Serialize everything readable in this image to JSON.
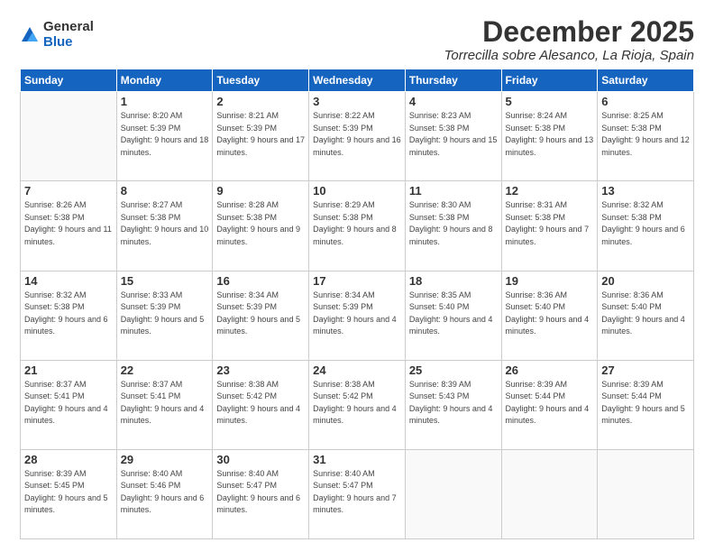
{
  "logo": {
    "general": "General",
    "blue": "Blue"
  },
  "title": "December 2025",
  "location": "Torrecilla sobre Alesanco, La Rioja, Spain",
  "days_of_week": [
    "Sunday",
    "Monday",
    "Tuesday",
    "Wednesday",
    "Thursday",
    "Friday",
    "Saturday"
  ],
  "weeks": [
    [
      {
        "day": "",
        "sunrise": "",
        "sunset": "",
        "daylight": ""
      },
      {
        "day": "1",
        "sunrise": "Sunrise: 8:20 AM",
        "sunset": "Sunset: 5:39 PM",
        "daylight": "Daylight: 9 hours and 18 minutes."
      },
      {
        "day": "2",
        "sunrise": "Sunrise: 8:21 AM",
        "sunset": "Sunset: 5:39 PM",
        "daylight": "Daylight: 9 hours and 17 minutes."
      },
      {
        "day": "3",
        "sunrise": "Sunrise: 8:22 AM",
        "sunset": "Sunset: 5:39 PM",
        "daylight": "Daylight: 9 hours and 16 minutes."
      },
      {
        "day": "4",
        "sunrise": "Sunrise: 8:23 AM",
        "sunset": "Sunset: 5:38 PM",
        "daylight": "Daylight: 9 hours and 15 minutes."
      },
      {
        "day": "5",
        "sunrise": "Sunrise: 8:24 AM",
        "sunset": "Sunset: 5:38 PM",
        "daylight": "Daylight: 9 hours and 13 minutes."
      },
      {
        "day": "6",
        "sunrise": "Sunrise: 8:25 AM",
        "sunset": "Sunset: 5:38 PM",
        "daylight": "Daylight: 9 hours and 12 minutes."
      }
    ],
    [
      {
        "day": "7",
        "sunrise": "Sunrise: 8:26 AM",
        "sunset": "Sunset: 5:38 PM",
        "daylight": "Daylight: 9 hours and 11 minutes."
      },
      {
        "day": "8",
        "sunrise": "Sunrise: 8:27 AM",
        "sunset": "Sunset: 5:38 PM",
        "daylight": "Daylight: 9 hours and 10 minutes."
      },
      {
        "day": "9",
        "sunrise": "Sunrise: 8:28 AM",
        "sunset": "Sunset: 5:38 PM",
        "daylight": "Daylight: 9 hours and 9 minutes."
      },
      {
        "day": "10",
        "sunrise": "Sunrise: 8:29 AM",
        "sunset": "Sunset: 5:38 PM",
        "daylight": "Daylight: 9 hours and 8 minutes."
      },
      {
        "day": "11",
        "sunrise": "Sunrise: 8:30 AM",
        "sunset": "Sunset: 5:38 PM",
        "daylight": "Daylight: 9 hours and 8 minutes."
      },
      {
        "day": "12",
        "sunrise": "Sunrise: 8:31 AM",
        "sunset": "Sunset: 5:38 PM",
        "daylight": "Daylight: 9 hours and 7 minutes."
      },
      {
        "day": "13",
        "sunrise": "Sunrise: 8:32 AM",
        "sunset": "Sunset: 5:38 PM",
        "daylight": "Daylight: 9 hours and 6 minutes."
      }
    ],
    [
      {
        "day": "14",
        "sunrise": "Sunrise: 8:32 AM",
        "sunset": "Sunset: 5:38 PM",
        "daylight": "Daylight: 9 hours and 6 minutes."
      },
      {
        "day": "15",
        "sunrise": "Sunrise: 8:33 AM",
        "sunset": "Sunset: 5:39 PM",
        "daylight": "Daylight: 9 hours and 5 minutes."
      },
      {
        "day": "16",
        "sunrise": "Sunrise: 8:34 AM",
        "sunset": "Sunset: 5:39 PM",
        "daylight": "Daylight: 9 hours and 5 minutes."
      },
      {
        "day": "17",
        "sunrise": "Sunrise: 8:34 AM",
        "sunset": "Sunset: 5:39 PM",
        "daylight": "Daylight: 9 hours and 4 minutes."
      },
      {
        "day": "18",
        "sunrise": "Sunrise: 8:35 AM",
        "sunset": "Sunset: 5:40 PM",
        "daylight": "Daylight: 9 hours and 4 minutes."
      },
      {
        "day": "19",
        "sunrise": "Sunrise: 8:36 AM",
        "sunset": "Sunset: 5:40 PM",
        "daylight": "Daylight: 9 hours and 4 minutes."
      },
      {
        "day": "20",
        "sunrise": "Sunrise: 8:36 AM",
        "sunset": "Sunset: 5:40 PM",
        "daylight": "Daylight: 9 hours and 4 minutes."
      }
    ],
    [
      {
        "day": "21",
        "sunrise": "Sunrise: 8:37 AM",
        "sunset": "Sunset: 5:41 PM",
        "daylight": "Daylight: 9 hours and 4 minutes."
      },
      {
        "day": "22",
        "sunrise": "Sunrise: 8:37 AM",
        "sunset": "Sunset: 5:41 PM",
        "daylight": "Daylight: 9 hours and 4 minutes."
      },
      {
        "day": "23",
        "sunrise": "Sunrise: 8:38 AM",
        "sunset": "Sunset: 5:42 PM",
        "daylight": "Daylight: 9 hours and 4 minutes."
      },
      {
        "day": "24",
        "sunrise": "Sunrise: 8:38 AM",
        "sunset": "Sunset: 5:42 PM",
        "daylight": "Daylight: 9 hours and 4 minutes."
      },
      {
        "day": "25",
        "sunrise": "Sunrise: 8:39 AM",
        "sunset": "Sunset: 5:43 PM",
        "daylight": "Daylight: 9 hours and 4 minutes."
      },
      {
        "day": "26",
        "sunrise": "Sunrise: 8:39 AM",
        "sunset": "Sunset: 5:44 PM",
        "daylight": "Daylight: 9 hours and 4 minutes."
      },
      {
        "day": "27",
        "sunrise": "Sunrise: 8:39 AM",
        "sunset": "Sunset: 5:44 PM",
        "daylight": "Daylight: 9 hours and 5 minutes."
      }
    ],
    [
      {
        "day": "28",
        "sunrise": "Sunrise: 8:39 AM",
        "sunset": "Sunset: 5:45 PM",
        "daylight": "Daylight: 9 hours and 5 minutes."
      },
      {
        "day": "29",
        "sunrise": "Sunrise: 8:40 AM",
        "sunset": "Sunset: 5:46 PM",
        "daylight": "Daylight: 9 hours and 6 minutes."
      },
      {
        "day": "30",
        "sunrise": "Sunrise: 8:40 AM",
        "sunset": "Sunset: 5:47 PM",
        "daylight": "Daylight: 9 hours and 6 minutes."
      },
      {
        "day": "31",
        "sunrise": "Sunrise: 8:40 AM",
        "sunset": "Sunset: 5:47 PM",
        "daylight": "Daylight: 9 hours and 7 minutes."
      },
      {
        "day": "",
        "sunrise": "",
        "sunset": "",
        "daylight": ""
      },
      {
        "day": "",
        "sunrise": "",
        "sunset": "",
        "daylight": ""
      },
      {
        "day": "",
        "sunrise": "",
        "sunset": "",
        "daylight": ""
      }
    ]
  ]
}
